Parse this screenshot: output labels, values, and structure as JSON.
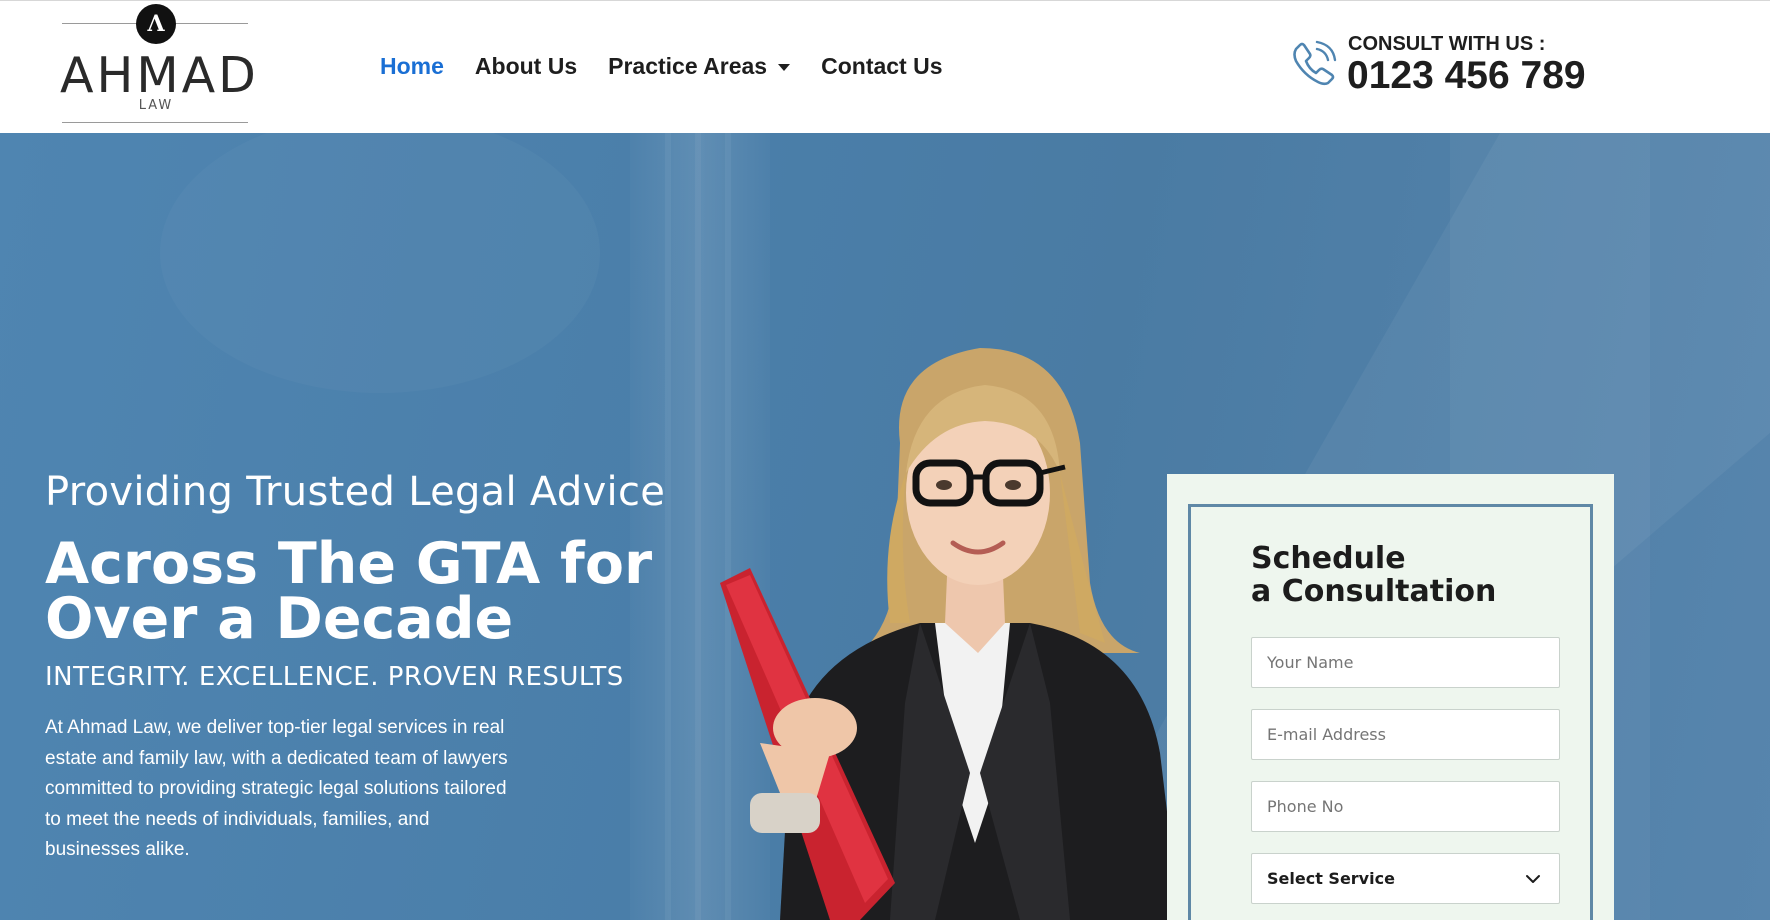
{
  "logo": {
    "badge": "Λ",
    "name": "AHMAD",
    "sub": "LAW"
  },
  "nav": {
    "items": [
      {
        "label": "Home",
        "active": true
      },
      {
        "label": "About Us",
        "active": false
      },
      {
        "label": "Practice Areas",
        "active": false,
        "has_dropdown": true
      },
      {
        "label": "Contact Us",
        "active": false
      }
    ]
  },
  "consult": {
    "label": "CONSULT WITH US :",
    "number": "0123 456 789",
    "icon": "phone-icon"
  },
  "hero": {
    "tagline": "Providing Trusted Legal Advice",
    "headline": "Across The GTA for Over a Decade",
    "values": "INTEGRITY. EXCELLENCE. PROVEN RESULTS",
    "description": "At Ahmad Law, we deliver top-tier legal services in real estate and family law, with a dedicated team of lawyers committed to providing strategic legal solutions tailored to meet the needs of individuals, families, and businesses alike."
  },
  "form": {
    "title_line1": "Schedule",
    "title_line2": "a Consultation",
    "name_placeholder": "Your Name",
    "email_placeholder": "E-mail Address",
    "phone_placeholder": "Phone No",
    "service_selected": "Select Service"
  },
  "colors": {
    "accent": "#1a6fd4",
    "hero_bg": "#4a7ea9",
    "form_bg": "#eef6ee",
    "form_border": "#5f88a6"
  }
}
